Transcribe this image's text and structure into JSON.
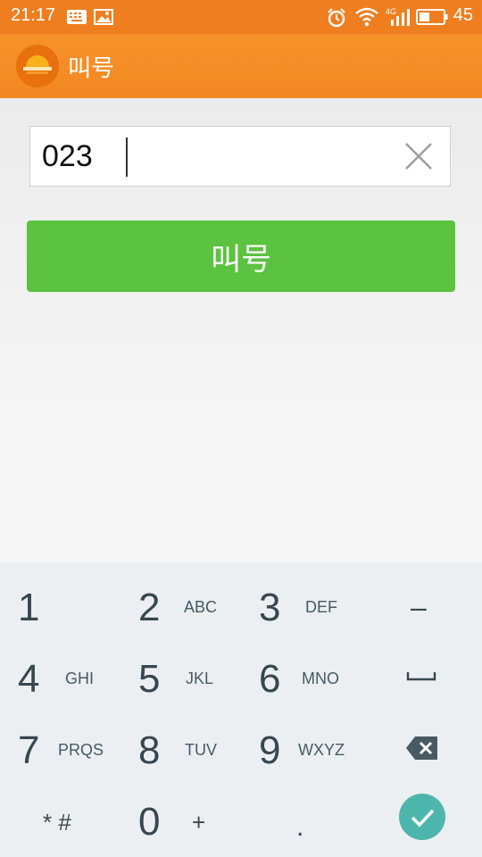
{
  "status_bar": {
    "time": "21:17",
    "network_label": "4G",
    "battery_percent": "45",
    "battery_level": 0.45,
    "icons": [
      "keyboard-notification-icon",
      "image-notification-icon",
      "alarm-icon",
      "wifi-icon",
      "signal-icon",
      "battery-icon"
    ]
  },
  "app_bar": {
    "title": "叫号",
    "logo_icon": "app-logo",
    "color": "#f28823"
  },
  "form": {
    "number_input": {
      "value": "023"
    },
    "clear_icon": "close-icon",
    "call_button_label": "叫号",
    "call_button_color": "#5bc33f"
  },
  "keypad": {
    "keys": [
      {
        "digit": "1",
        "letters": ""
      },
      {
        "digit": "2",
        "letters": "ABC"
      },
      {
        "digit": "3",
        "letters": "DEF"
      },
      {
        "digit": "4",
        "letters": "GHI"
      },
      {
        "digit": "5",
        "letters": "JKL"
      },
      {
        "digit": "6",
        "letters": "MNO"
      },
      {
        "digit": "7",
        "letters": "PRQS"
      },
      {
        "digit": "8",
        "letters": "TUV"
      },
      {
        "digit": "9",
        "letters": "WXYZ"
      },
      {
        "digit": "0",
        "letters": ""
      }
    ],
    "symbols": {
      "star_hash": "* #",
      "plus": "+",
      "dot": ".",
      "minus": "–"
    },
    "space_icon": "space-icon",
    "backspace_icon": "backspace-icon",
    "done_icon": "checkmark-icon",
    "done_color": "#4db6ac"
  }
}
